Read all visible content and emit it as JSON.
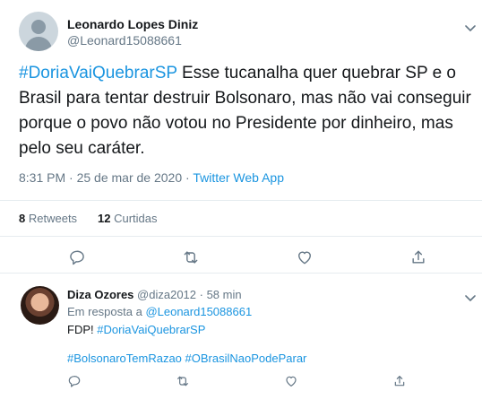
{
  "main_tweet": {
    "author_name": "Leonardo Lopes Diniz",
    "author_handle": "@Leonard15088661",
    "hashtag": "#DoriaVaiQuebrarSP",
    "text": " Esse tucanalha quer quebrar SP e o Brasil para tentar destruir Bolsonaro, mas não vai conseguir porque o povo não votou no Presidente por dinheiro, mas pelo seu caráter.",
    "timestamp": "8:31 PM · 25 de mar de 2020",
    "separator": " · ",
    "source": "Twitter Web App",
    "retweets_count": "8",
    "retweets_label": "Retweets",
    "likes_count": "12",
    "likes_label": "Curtidas"
  },
  "reply": {
    "author_name": "Diza Ozores",
    "author_handle": "@diza2012",
    "time": "· 58 min",
    "reply_prefix": "Em resposta a ",
    "reply_to": "@Leonard15088661",
    "text_prefix": "FDP! ",
    "hashtag_1": "#DoriaVaiQuebrarSP",
    "hashtag_2": "#BolsonaroTemRazao",
    "hashtag_3": "#OBrasilNaoPodeParar"
  },
  "icons": [
    "chevron-down-icon",
    "reply-icon",
    "retweet-icon",
    "like-icon",
    "share-icon"
  ],
  "colors": {
    "link": "#1b95e0",
    "muted": "#657786",
    "text": "#14171a",
    "divider": "#e6ecf0"
  }
}
